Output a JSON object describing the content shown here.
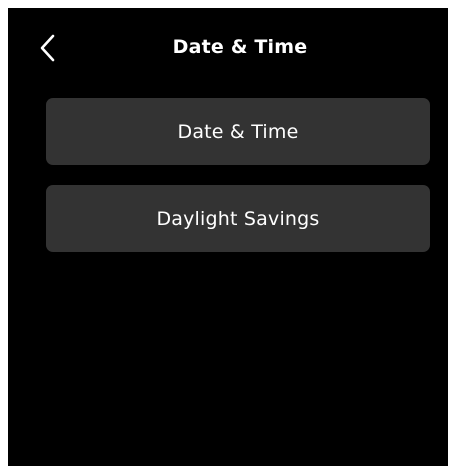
{
  "header": {
    "back_icon": "chevron-left-icon",
    "title": "Date & Time"
  },
  "menu": {
    "items": [
      {
        "label": "Date & Time"
      },
      {
        "label": "Daylight Savings"
      }
    ]
  },
  "colors": {
    "background": "#000000",
    "button": "#333333",
    "text": "#ffffff"
  }
}
